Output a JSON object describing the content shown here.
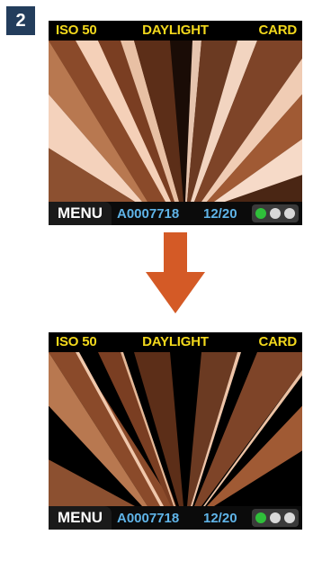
{
  "step": {
    "number": "2"
  },
  "screens": [
    {
      "status": {
        "iso": "ISO 50",
        "white_balance": "DAYLIGHT",
        "storage": "CARD"
      },
      "footer": {
        "menu_label": "MENU",
        "file_name": "A0007718",
        "frame_count": "12/20"
      },
      "battery": {
        "icon": "battery-indicator-icon",
        "dots": [
          "#2fbf3a",
          "#d9d9d9",
          "#d9d9d9"
        ]
      }
    },
    {
      "status": {
        "iso": "ISO 50",
        "white_balance": "DAYLIGHT",
        "storage": "CARD"
      },
      "footer": {
        "menu_label": "MENU",
        "file_name": "A0007718",
        "frame_count": "12/20"
      },
      "battery": {
        "icon": "battery-indicator-icon",
        "dots": [
          "#2fbf3a",
          "#d9d9d9",
          "#d9d9d9"
        ]
      }
    }
  ],
  "arrow": {
    "icon": "down-arrow-icon",
    "color": "#d45a26"
  }
}
